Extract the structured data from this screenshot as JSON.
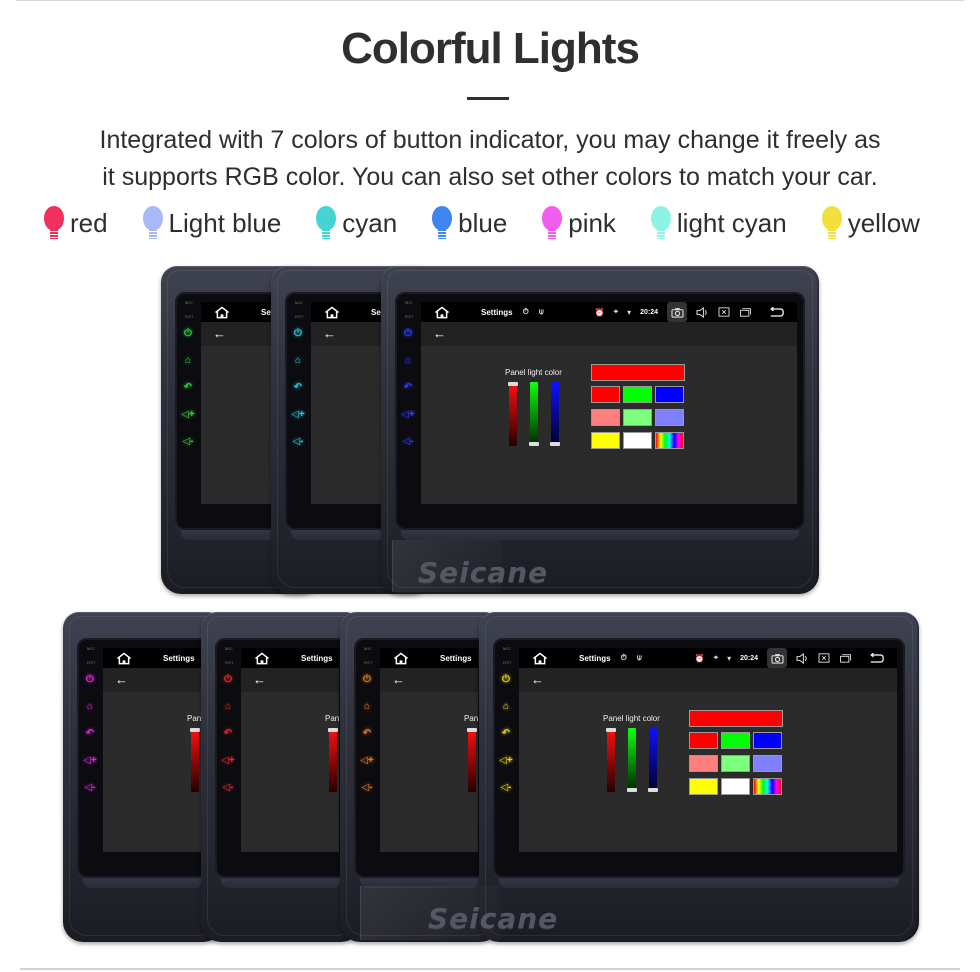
{
  "header": {
    "title": "Colorful Lights",
    "description_line1": "Integrated with 7 colors of button indicator, you may change it freely as",
    "description_line2": "it supports RGB color. You can also set other colors to match your car."
  },
  "legend": [
    {
      "label": "red",
      "color": "#f0305f",
      "icon": "bulb-icon"
    },
    {
      "label": "Light blue",
      "color": "#a9b9f7",
      "icon": "bulb-icon"
    },
    {
      "label": "cyan",
      "color": "#46d3d3",
      "icon": "bulb-icon"
    },
    {
      "label": "blue",
      "color": "#3f84ef",
      "icon": "bulb-icon"
    },
    {
      "label": "pink",
      "color": "#f25cf0",
      "icon": "bulb-icon"
    },
    {
      "label": "light cyan",
      "color": "#8df3e6",
      "icon": "bulb-icon"
    },
    {
      "label": "yellow",
      "color": "#f2e03e",
      "icon": "bulb-icon"
    }
  ],
  "device": {
    "mic_label": "MIC",
    "rst_label": "RST",
    "side_keys": [
      "power-icon",
      "home-icon",
      "back-icon",
      "volume-up-icon",
      "volume-down-icon"
    ],
    "side_key_glyphs": [
      "⏻",
      "⌂",
      "↶",
      "◁+",
      "◁-"
    ],
    "watermark": "Seicane"
  },
  "screen": {
    "title": "Settings",
    "time": "20:24",
    "status_left_icons": [
      "timer-icon",
      "usb-icon"
    ],
    "status_right_icons": [
      "alarm-icon",
      "location-icon",
      "wifi-icon"
    ],
    "nav_icons": [
      "camera-icon",
      "volume-icon",
      "close-window-icon",
      "recent-apps-icon",
      "return-icon"
    ],
    "panel_label": "Panel light color",
    "sliders": [
      {
        "channel": "red",
        "value": 1.0
      },
      {
        "channel": "green",
        "value": 0.0
      },
      {
        "channel": "blue",
        "value": 0.0
      }
    ],
    "preview_color": "#ff0000",
    "swatches": [
      "#ff0000",
      "#00ff00",
      "#0000ff",
      "#ff7f7f",
      "#7fff7f",
      "#7f7fff",
      "#ffff00",
      "#ffffff",
      "rainbow"
    ]
  },
  "units_top": [
    {
      "led_color": "#2fd13a"
    },
    {
      "led_color": "#27c4d6"
    },
    {
      "led_color": "#2f3cff"
    }
  ],
  "units_bottom": [
    {
      "led_color": "#d62ad9"
    },
    {
      "led_color": "#e02a2a"
    },
    {
      "led_color": "#e07a1e"
    },
    {
      "led_color": "#e6d21a"
    }
  ]
}
